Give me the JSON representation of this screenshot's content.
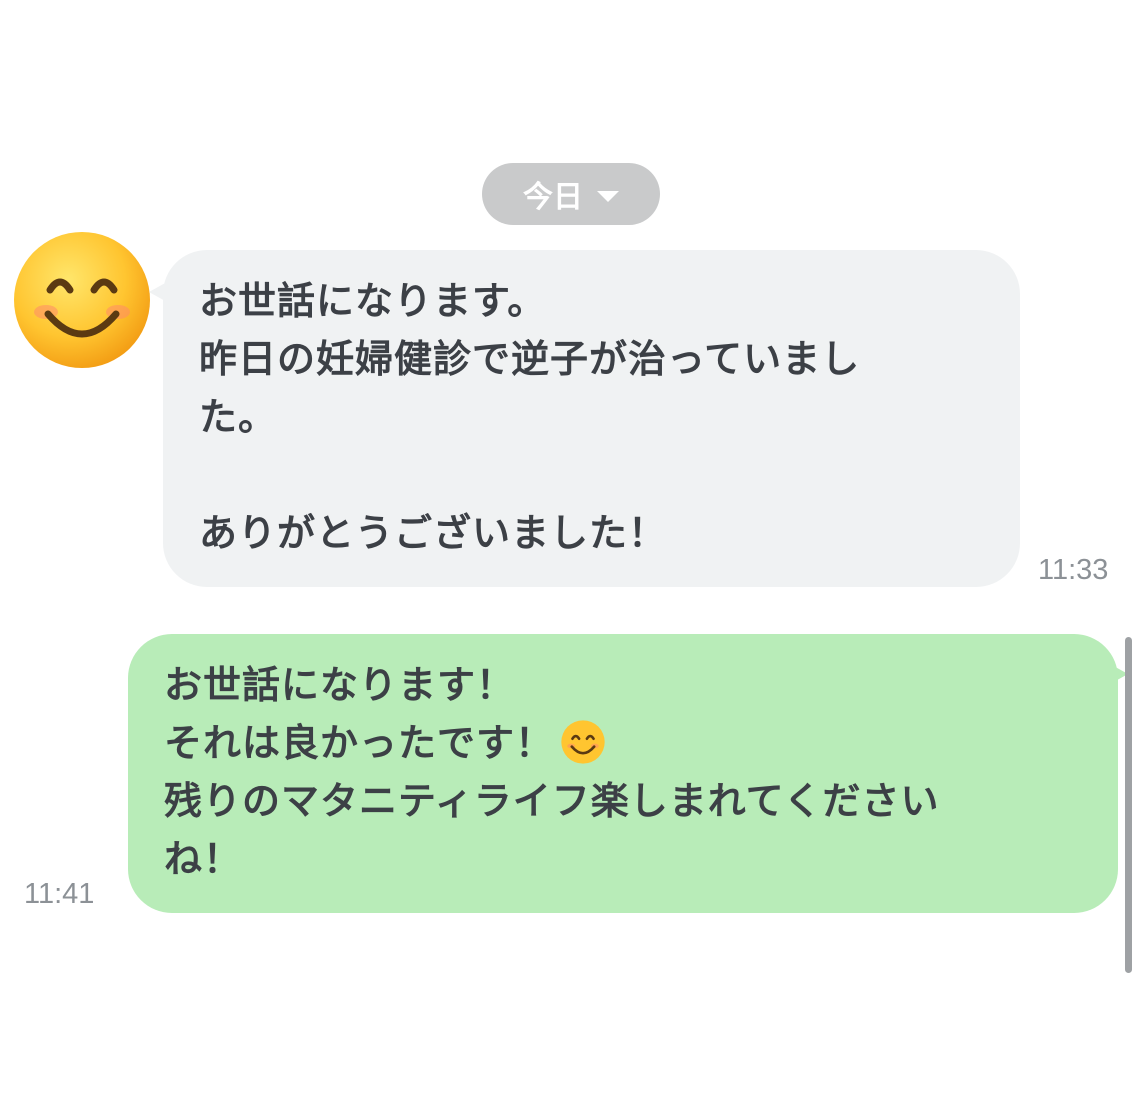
{
  "date_separator": {
    "label": "今日",
    "icon": "chevron-down-icon"
  },
  "incoming": {
    "avatar_icon": "smiling-face-with-smiling-eyes-icon",
    "lines": [
      "お世話になります。",
      "昨日の妊婦健診で逆子が治っていまし",
      "た。",
      "",
      "ありがとうございました！"
    ],
    "time": "11:33",
    "bubble_color": "#f0f2f3"
  },
  "outgoing": {
    "lines": [
      "お世話になります！",
      "それは良かったです！",
      "残りのマタニティライフ楽しまれてください",
      "ね！"
    ],
    "inline_emoji_icon": "smiling-face-with-smiling-eyes-icon",
    "time": "11:41",
    "bubble_color": "#b8ecb8"
  }
}
